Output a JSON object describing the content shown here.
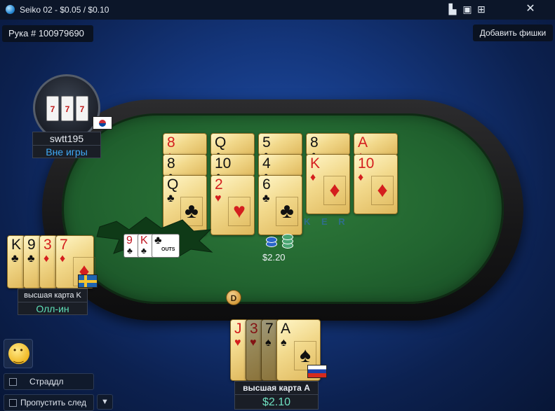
{
  "window": {
    "title": "Seiko 02 - $0.05 / $0.10",
    "buttons": [
      "layout-icon",
      "lobby-icon",
      "grid-icon",
      "close-icon"
    ]
  },
  "header": {
    "hand_number": "Рука # 100979690",
    "add_chips_label": "Добавить фишки"
  },
  "table": {
    "felt_logo": "K E R",
    "board": [
      [
        {
          "rank": "8",
          "suit": "♦",
          "color": "red"
        },
        {
          "rank": "8",
          "suit": "♣",
          "color": "black"
        },
        {
          "rank": "Q",
          "suit": "♣",
          "color": "black"
        }
      ],
      [
        {
          "rank": "Q",
          "suit": "♣",
          "color": "black"
        },
        {
          "rank": "10",
          "suit": "♣",
          "color": "black"
        },
        {
          "rank": "2",
          "suit": "♥",
          "color": "red"
        }
      ],
      [
        {
          "rank": "5",
          "suit": "♣",
          "color": "black"
        },
        {
          "rank": "4",
          "suit": "♣",
          "color": "black"
        },
        {
          "rank": "6",
          "suit": "♣",
          "color": "black"
        }
      ],
      [
        {
          "rank": "8",
          "suit": "♣",
          "color": "black"
        },
        {
          "rank": "K",
          "suit": "♦",
          "color": "red"
        }
      ],
      [
        {
          "rank": "A",
          "suit": "♦",
          "color": "red"
        },
        {
          "rank": "10",
          "suit": "♦",
          "color": "red"
        }
      ]
    ],
    "outs": {
      "label": "OUTS",
      "cards": [
        {
          "rank": "9",
          "suit": "♣",
          "color": "red"
        },
        {
          "rank": "K",
          "suit": "♣",
          "color": "red"
        },
        {
          "rank": "♣",
          "suit": "",
          "color": "black"
        }
      ]
    },
    "pot": "$2.20",
    "dealer_button": "D"
  },
  "players": {
    "top_left": {
      "name": "swtt195",
      "status": "Вне игры",
      "flag": "kr",
      "status_color": "#3fa9f5",
      "avatar_reels": [
        "7",
        "7",
        "7"
      ]
    },
    "left": {
      "hand_label": "высшая карта K",
      "status": "Олл-ин",
      "status_color": "#5fe0b8",
      "flag": "se",
      "cards": [
        {
          "rank": "K",
          "suit": "♣",
          "color": "black"
        },
        {
          "rank": "9",
          "suit": "♣",
          "color": "black"
        },
        {
          "rank": "3",
          "suit": "♦",
          "color": "red"
        },
        {
          "rank": "7",
          "suit": "♦",
          "color": "red"
        }
      ]
    },
    "hero": {
      "hand_label": "высшая карта А",
      "stack": "$2.10",
      "stack_color": "#6fe0c0",
      "flag": "ru",
      "cards": [
        {
          "rank": "J",
          "suit": "♥",
          "color": "red"
        },
        {
          "rank": "3",
          "suit": "♥",
          "color": "red"
        },
        {
          "rank": "7",
          "suit": "♠",
          "color": "black"
        },
        {
          "rank": "A",
          "suit": "♠",
          "color": "black"
        }
      ]
    }
  },
  "controls": {
    "emoji_icon": "smiley-icon",
    "straddle_label": "Страддл",
    "skip_next_label": "Пропустить след"
  }
}
